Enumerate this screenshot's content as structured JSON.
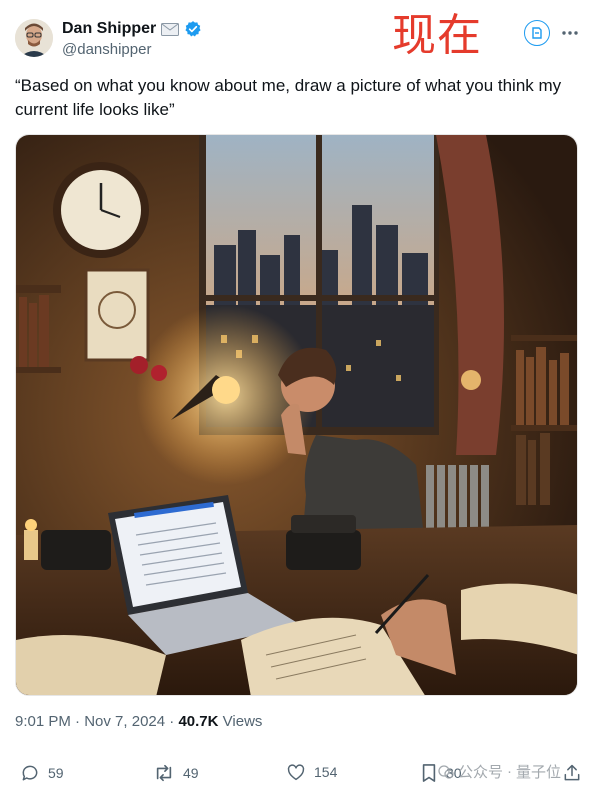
{
  "author": {
    "name": "Dan Shipper",
    "handle": "@danshipper",
    "badge_icons": [
      "mail-icon",
      "verified-icon"
    ],
    "verified_color": "#1d9bf0"
  },
  "overlay_label": "现在",
  "tweet": {
    "text": "“Based on what you know about me, draw a picture of what you think my current life looks like”"
  },
  "meta": {
    "time": "9:01 PM",
    "separator": "·",
    "date": "Nov 7, 2024",
    "views_count": "40.7K",
    "views_label": "Views"
  },
  "actions": {
    "replies": "59",
    "reposts": "49",
    "likes": "154",
    "bookmarks": "30"
  },
  "watermark": {
    "text1": "公众号",
    "separator": "·",
    "text2": "量子位"
  },
  "colors": {
    "accent": "#1d9bf0",
    "overlay_red": "#e53b2c",
    "secondary_text": "#536471"
  }
}
